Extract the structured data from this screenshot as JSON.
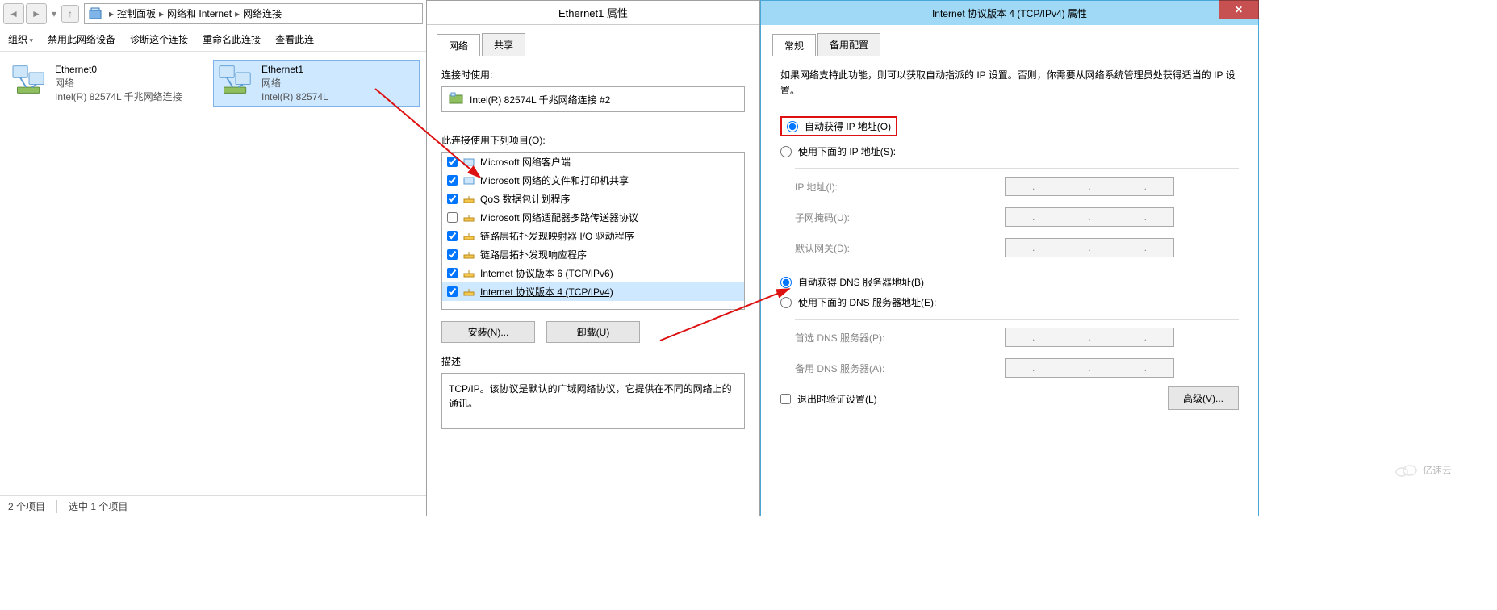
{
  "explorer": {
    "breadcrumb": {
      "root": "控制面板",
      "mid": "网络和 Internet",
      "leaf": "网络连接"
    },
    "toolbar": {
      "organize": "组织",
      "disable": "禁用此网络设备",
      "diagnose": "诊断这个连接",
      "rename": "重命名此连接",
      "view": "查看此连"
    },
    "connections": [
      {
        "name": "Ethernet0",
        "status": "网络",
        "adapter": "Intel(R) 82574L 千兆网络连接"
      },
      {
        "name": "Ethernet1",
        "status": "网络",
        "adapter": "Intel(R) 82574L"
      }
    ],
    "status": {
      "count": "2 个项目",
      "selected": "选中 1 个项目"
    }
  },
  "ethDialog": {
    "title": "Ethernet1 属性",
    "tabs": {
      "network": "网络",
      "share": "共享"
    },
    "connectUsing": "连接时使用:",
    "adapter": "Intel(R) 82574L 千兆网络连接 #2",
    "itemsLabel": "此连接使用下列项目(O):",
    "items": [
      {
        "checked": true,
        "label": "Microsoft 网络客户端"
      },
      {
        "checked": true,
        "label": "Microsoft 网络的文件和打印机共享"
      },
      {
        "checked": true,
        "label": "QoS 数据包计划程序"
      },
      {
        "checked": false,
        "label": "Microsoft 网络适配器多路传送器协议"
      },
      {
        "checked": true,
        "label": "链路层拓扑发现映射器 I/O 驱动程序"
      },
      {
        "checked": true,
        "label": "链路层拓扑发现响应程序"
      },
      {
        "checked": true,
        "label": "Internet 协议版本 6 (TCP/IPv6)"
      },
      {
        "checked": true,
        "label": "Internet 协议版本 4 (TCP/IPv4)"
      }
    ],
    "buttons": {
      "install": "安装(N)...",
      "uninstall": "卸载(U)"
    },
    "descLabel": "描述",
    "descText": "TCP/IP。该协议是默认的广域网络协议，它提供在不同的网络上的通讯。"
  },
  "ipv4Dialog": {
    "title": "Internet 协议版本 4 (TCP/IPv4) 属性",
    "tabs": {
      "general": "常规",
      "alt": "备用配置"
    },
    "infoText": "如果网络支持此功能，则可以获取自动指派的 IP 设置。否则，你需要从网络系统管理员处获得适当的 IP 设置。",
    "ipAuto": "自动获得 IP 地址(O)",
    "ipManual": "使用下面的 IP 地址(S):",
    "ipAddr": "IP 地址(I):",
    "subnet": "子网掩码(U):",
    "gateway": "默认网关(D):",
    "dnsAuto": "自动获得 DNS 服务器地址(B)",
    "dnsManual": "使用下面的 DNS 服务器地址(E):",
    "dnsPref": "首选 DNS 服务器(P):",
    "dnsAlt": "备用 DNS 服务器(A):",
    "exitValidate": "退出时验证设置(L)",
    "advanced": "高级(V)..."
  },
  "watermark": "亿速云"
}
